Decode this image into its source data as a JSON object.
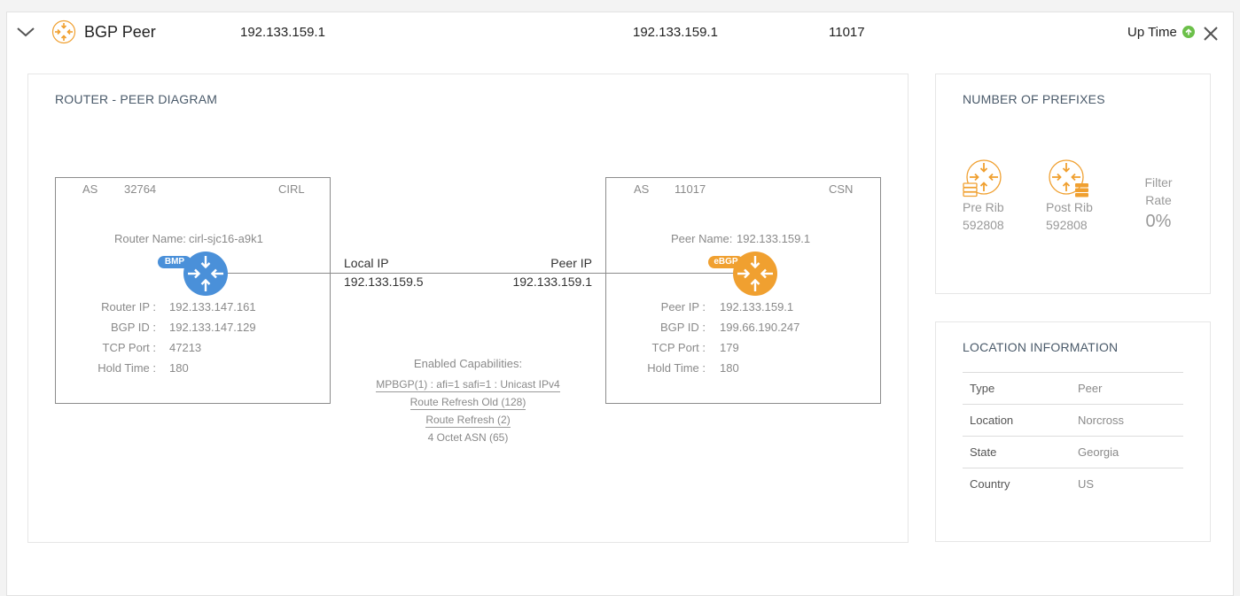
{
  "header": {
    "title": "BGP Peer",
    "ip1": "192.133.159.1",
    "ip2": "192.133.159.1",
    "asn": "11017",
    "status_label": "Up Time"
  },
  "diagram": {
    "title": "ROUTER - PEER DIAGRAM",
    "router": {
      "as_label": "AS",
      "as_value": "32764",
      "org": "CIRL",
      "name_label": "Router Name:",
      "name_value": "cirl-sjc16-a9k1",
      "badge": "BMP",
      "fields": [
        {
          "label": "Router IP :",
          "value": "192.133.147.161"
        },
        {
          "label": "BGP ID :",
          "value": "192.133.147.129"
        },
        {
          "label": "TCP Port :",
          "value": "47213"
        },
        {
          "label": "Hold Time :",
          "value": "180"
        }
      ]
    },
    "peer": {
      "as_label": "AS",
      "as_value": "11017",
      "org": "CSN",
      "name_label": "Peer Name:",
      "name_value": "192.133.159.1",
      "badge": "eBGP",
      "fields": [
        {
          "label": "Peer IP :",
          "value": "192.133.159.1"
        },
        {
          "label": "BGP ID :",
          "value": "199.66.190.247"
        },
        {
          "label": "TCP Port :",
          "value": "179"
        },
        {
          "label": "Hold Time :",
          "value": "180"
        }
      ]
    },
    "link": {
      "local_label": "Local IP",
      "local_ip": "192.133.159.5",
      "peer_label": "Peer IP",
      "peer_ip": "192.133.159.1"
    },
    "capabilities": {
      "title": "Enabled Capabilities:",
      "items": [
        "MPBGP(1) : afi=1 safi=1 : Unicast IPv4",
        "Route Refresh Old (128)",
        "Route Refresh (2)",
        "4 Octet ASN (65)"
      ]
    }
  },
  "prefixes": {
    "title": "NUMBER OF PREFIXES",
    "pre_rib_label": "Pre Rib",
    "pre_rib_value": "592808",
    "post_rib_label": "Post Rib",
    "post_rib_value": "592808",
    "filter_label_1": "Filter",
    "filter_label_2": "Rate",
    "filter_value": "0%"
  },
  "location": {
    "title": "LOCATION INFORMATION",
    "rows": [
      {
        "key": "Type",
        "value": "Peer"
      },
      {
        "key": "Location",
        "value": "Norcross"
      },
      {
        "key": "State",
        "value": "Georgia"
      },
      {
        "key": "Country",
        "value": "US"
      }
    ]
  },
  "colors": {
    "accent_orange": "#f0a030",
    "accent_blue": "#4a90d9",
    "status_green": "#6cc04a"
  }
}
